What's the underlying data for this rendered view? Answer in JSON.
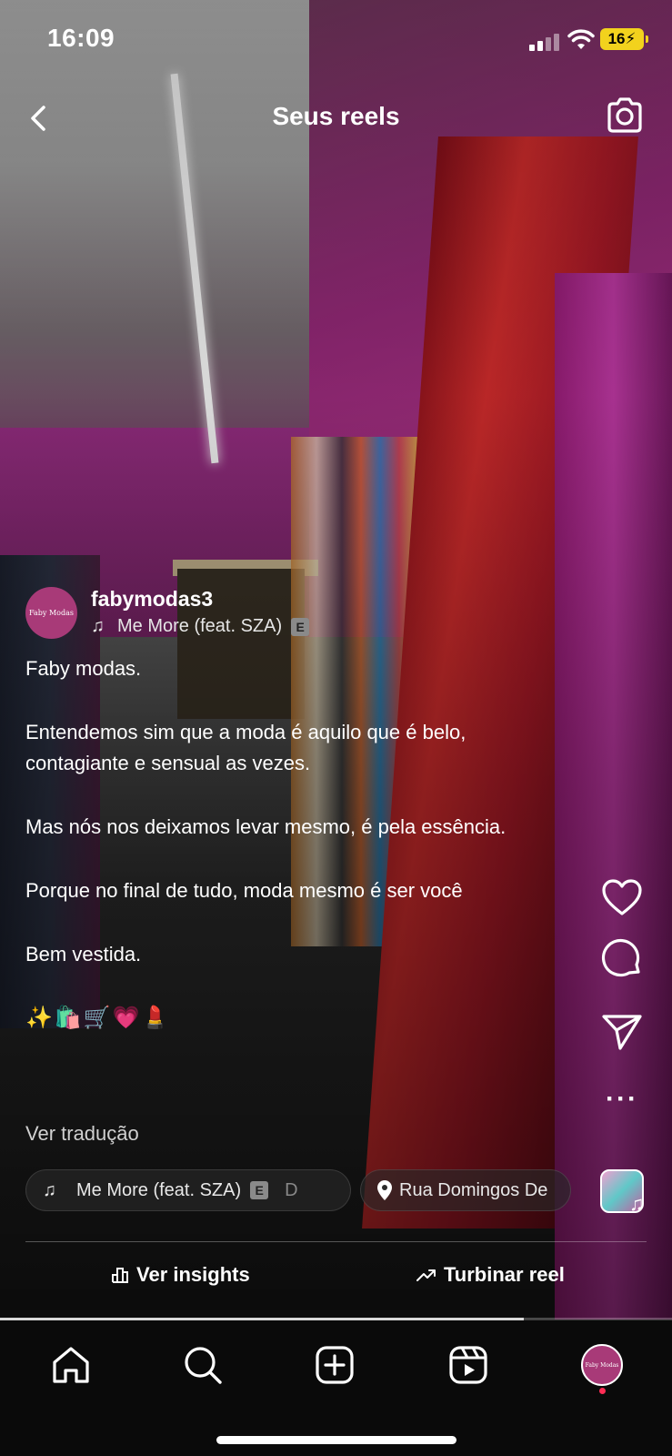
{
  "status_bar": {
    "time": "16:09",
    "battery": "16"
  },
  "header": {
    "title": "Seus reels"
  },
  "post": {
    "username": "fabymodas3",
    "avatar_text": "Faby Modas",
    "audio": "Me More (feat. SZA)",
    "explicit": "E",
    "caption": [
      "Faby modas.",
      "Entendemos  sim que a moda é aquilo que é belo, contagiante e sensual as vezes.",
      "Mas nós  nos deixamos levar mesmo, é pela essência.",
      "Porque no final de tudo, moda mesmo é ser você",
      "Bem vestida."
    ],
    "emojis": "✨🛍️🛒💗💄",
    "translate": "Ver tradução"
  },
  "chips": {
    "audio_label": "Me More (feat. SZA)",
    "audio_explicit": "E",
    "audio_overflow": "D",
    "location": "Rua Domingos De"
  },
  "actions": {
    "insights": "Ver insights",
    "boost": "Turbinar reel"
  },
  "progress": 0.78,
  "icons": {
    "back": "chevron-left-icon",
    "camera": "camera-icon",
    "like": "heart-icon",
    "comment": "comment-icon",
    "share": "send-icon",
    "more": "more-icon",
    "home": "home-icon",
    "search": "search-icon",
    "create": "add-icon",
    "reels": "reels-icon"
  },
  "colors": {
    "accent": "#a83a78",
    "notification": "#ff2d55",
    "battery": "#f2d21d"
  }
}
